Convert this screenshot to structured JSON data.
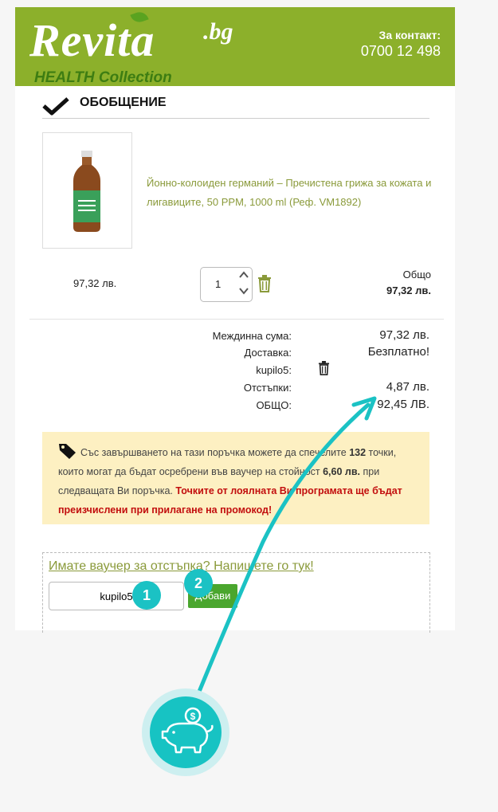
{
  "header": {
    "logo_main": "Revita",
    "logo_domain": ".bg",
    "logo_sub": "HEALTH Collection",
    "contact_label": "За контакт:",
    "contact_phone": "0700 12 498",
    "bg_color": "#8cb02b"
  },
  "summary": {
    "title": "ОБОБЩЕНИЕ"
  },
  "cart": {
    "item": {
      "name": "Йонно-колоиден германий – Пречистена грижа за кожата и лигавиците, 50 PPM, 1000 ml (Реф. VM1892)",
      "unit_price": "97,32 лв.",
      "quantity": "1",
      "total_label": "Общо",
      "total_value": "97,32 лв."
    }
  },
  "totals": {
    "subtotal_label": "Междинна сума:",
    "subtotal_value": "97,32 лв.",
    "shipping_label": "Доставка:",
    "shipping_value": "Безплатно!",
    "coupon_label": "kupilo5:",
    "discount_label": "Отстъпки:",
    "discount_value": "4,87 лв.",
    "grand_label": "ОБЩО:",
    "grand_value": "92,45 ЛВ."
  },
  "loyalty": {
    "text_1": "Със завършването на тази поръчка можете да спечелите",
    "points": "132",
    "text_2": "точки, които могат да бъдат осребрени във ваучер на стойност",
    "amount": "6,60 лв.",
    "text_3": "при следващата Ви поръчка.",
    "warning": "Точките от лоялната Ви програмата ще бъдат преизчислени при прилагане на промокод!"
  },
  "voucher": {
    "link_text": "Имате ваучер за отстъпка? Напишете го тук!",
    "input_value": "kupilo5",
    "button_label": "Добави"
  },
  "annotations": {
    "step1": "1",
    "step2": "2",
    "accent_color": "#1bc2c4"
  }
}
